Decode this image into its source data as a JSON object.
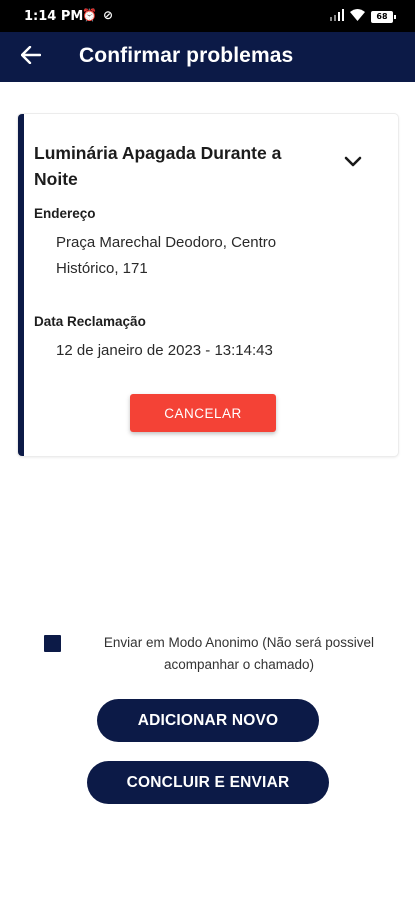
{
  "status_bar": {
    "time": "1:14 PM",
    "battery": "68",
    "icons": [
      "alarm-icon",
      "no-entry-icon",
      "signal-icon",
      "wifi-icon",
      "battery-icon"
    ]
  },
  "header": {
    "title": "Confirmar problemas",
    "back_icon": "arrow-left-icon",
    "background_color": "#0c1a47"
  },
  "problem_card": {
    "title": "Luminária Apagada Durante a Noite",
    "address_label": "Endereço",
    "address_line1": "Praça Marechal Deodoro, Centro",
    "address_line2": "Histórico, 171",
    "date_label": "Data Reclamação",
    "date_value": "12 de janeiro de 2023 - 13:14:43",
    "cancel_label": "CANCELAR",
    "cancel_color": "#f44236",
    "expand_icon": "chevron-down-icon"
  },
  "anonymous": {
    "line1": "Enviar em Modo Anonimo (Não será possivel",
    "line2": "acompanhar o chamado)",
    "checked": false
  },
  "actions": {
    "add_new_label": "ADICIONAR NOVO",
    "submit_label": "CONCLUIR E ENVIAR"
  }
}
